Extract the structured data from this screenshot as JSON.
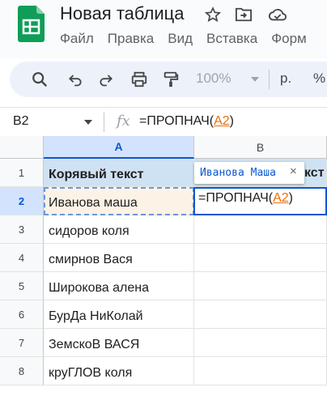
{
  "document": {
    "title": "Новая таблица"
  },
  "menu": [
    "Файл",
    "Правка",
    "Вид",
    "Вставка",
    "Форм"
  ],
  "toolbar": {
    "zoom": "100%",
    "currency": "р.",
    "percent": "%"
  },
  "formula_bar": {
    "name_box": "B2",
    "formula_prefix": "=ПРОПНАЧ(",
    "formula_ref": "A2",
    "formula_suffix": ")"
  },
  "columns": [
    "A",
    "B"
  ],
  "rows": [
    {
      "num": "1",
      "a": "Корявый текст",
      "b_visible": "кст"
    },
    {
      "num": "2",
      "a": "Иванова маша"
    },
    {
      "num": "3",
      "a": "сидоров коля"
    },
    {
      "num": "4",
      "a": "смирнов Вася"
    },
    {
      "num": "5",
      "a": "Широкова алена"
    },
    {
      "num": "6",
      "a": "БурДа НиКолай"
    },
    {
      "num": "7",
      "a": "ЗемскоВ ВАСЯ"
    },
    {
      "num": "8",
      "a": "круГЛОВ коля"
    }
  ],
  "active_cell": {
    "prefix": "=ПРОПНАЧ(",
    "ref": "A2",
    "suffix": ")"
  },
  "preview_tooltip": {
    "text": "Иванова Маша",
    "close": "×"
  },
  "colors": {
    "accent": "#0b57d0",
    "reference": "#e8710a",
    "header_fill": "#cfe2f3",
    "copy_fill": "#fdf2e6",
    "sheets_green": "#0f9d58"
  }
}
